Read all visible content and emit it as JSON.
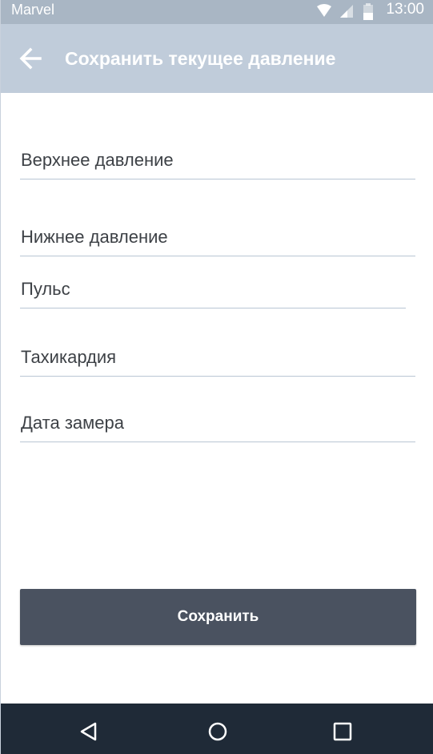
{
  "status_bar": {
    "carrier": "Marvel",
    "time": "13:00"
  },
  "app_bar": {
    "title": "Сохранить текущее давление",
    "back_icon": "arrow-left-icon"
  },
  "form": {
    "systolic_label": "Верхнее давление",
    "diastolic_label": "Нижнее давление",
    "pulse_label": "Пульс",
    "tachycardia_label": "Тахикардия",
    "date_label": "Дата замера"
  },
  "actions": {
    "save_label": "Сохранить"
  },
  "nav_bar": {
    "back_icon": "triangle-back-icon",
    "home_icon": "circle-home-icon",
    "recent_icon": "square-recent-icon"
  },
  "colors": {
    "status_bar": "#a9b6c4",
    "app_bar": "#c0ccda",
    "button": "#4a5260",
    "nav_bar": "#1f2a37",
    "divider": "#b9c6d4"
  }
}
